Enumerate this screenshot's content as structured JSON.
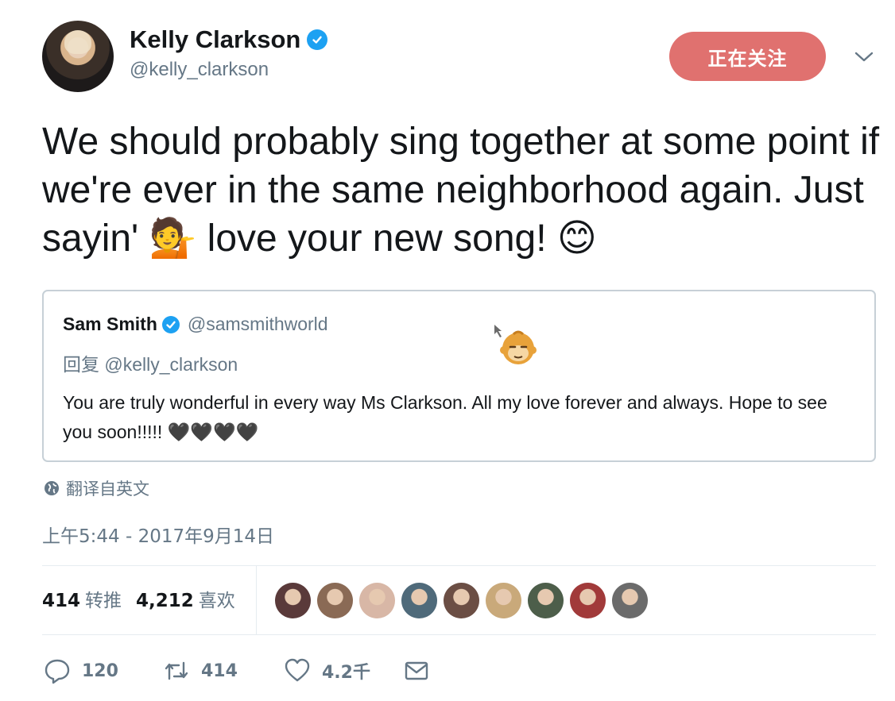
{
  "author": {
    "name": "Kelly Clarkson",
    "handle": "@kelly_clarkson",
    "verified": true,
    "follow_button_label": "正在关注"
  },
  "tweet": {
    "text": "We should probably sing together at some point if we're ever in the same neighborhood again. Just sayin' 💁 love your new song! 😊"
  },
  "quoted_tweet": {
    "name": "Sam Smith",
    "handle": "@samsmithworld",
    "verified": true,
    "reply_prefix": "回复",
    "reply_to": "@kelly_clarkson",
    "body": "You are truly wonderful in every way Ms Clarkson. All my love forever and always. Hope to see you soon!!!!! 🖤🖤🖤🖤"
  },
  "translate_label": "翻译自英文",
  "timestamp": "上午5:44 - 2017年9月14日",
  "stats": {
    "retweets_count": "414",
    "retweets_label": "转推",
    "likes_count": "4,212",
    "likes_label": "喜欢"
  },
  "likers": [
    {
      "color": "#5a3a3a"
    },
    {
      "color": "#8a6a55"
    },
    {
      "color": "#d8b7a6"
    },
    {
      "color": "#4f6a7a"
    },
    {
      "color": "#6b4e44"
    },
    {
      "color": "#c9a97a"
    },
    {
      "color": "#4d5e4a"
    },
    {
      "color": "#a13a3a"
    },
    {
      "color": "#6b6b6b"
    }
  ],
  "actions": {
    "reply_count": "120",
    "retweet_count": "414",
    "like_count": "4.2千"
  },
  "icons": {
    "verified": "verified-badge-icon",
    "caret": "chevron-down-icon",
    "globe": "globe-icon",
    "reply": "reply-icon",
    "retweet": "retweet-icon",
    "like": "heart-icon",
    "dm": "envelope-icon"
  },
  "colors": {
    "accent": "#1da1f2",
    "follow_button": "#e0716f",
    "secondary_text": "#657786",
    "border": "#c7d0d7"
  }
}
